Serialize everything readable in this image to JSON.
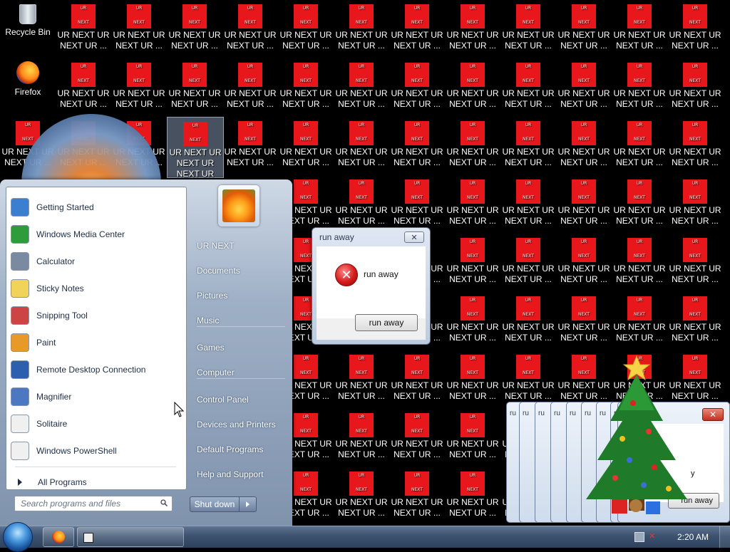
{
  "desktop": {
    "system_icons": [
      {
        "label": "Recycle Bin",
        "icon": "recycle-bin-icon"
      },
      {
        "label": "Firefox",
        "icon": "firefox-icon"
      }
    ],
    "shortcut": {
      "icon_top": "UR",
      "icon_bottom": "NEXT",
      "label_line1": "UR NEXT UR",
      "label_line2": "NEXT UR ...",
      "selected_label": [
        "UR NEXT UR",
        "NEXT UR",
        "NEXT UR"
      ],
      "icon_color": "#E8171B"
    }
  },
  "start_menu": {
    "pinned": [
      {
        "label": "Getting Started",
        "icon": "getting-started-icon"
      },
      {
        "label": "Windows Media Center",
        "icon": "media-center-icon"
      },
      {
        "label": "Calculator",
        "icon": "calculator-icon"
      },
      {
        "label": "Sticky Notes",
        "icon": "sticky-notes-icon"
      },
      {
        "label": "Snipping Tool",
        "icon": "snipping-tool-icon"
      },
      {
        "label": "Paint",
        "icon": "paint-icon"
      },
      {
        "label": "Remote Desktop Connection",
        "icon": "remote-desktop-icon"
      },
      {
        "label": "Magnifier",
        "icon": "magnifier-icon"
      },
      {
        "label": "Solitaire",
        "icon": "solitaire-icon"
      },
      {
        "label": "Windows PowerShell",
        "icon": "powershell-icon"
      }
    ],
    "all_programs": "All Programs",
    "search_placeholder": "Search programs and files",
    "right_items": [
      "UR NEXT",
      "Documents",
      "Pictures",
      "Music",
      "Games",
      "Computer",
      "Control Panel",
      "Devices and Printers",
      "Default Programs",
      "Help and Support"
    ],
    "shutdown_label": "Shut down"
  },
  "dialog": {
    "title": "run away",
    "message": "run away",
    "button": "run away",
    "close_glyph": "✕"
  },
  "stacked_windows": {
    "title_fragment": "ru",
    "front_close": "✕",
    "front_partial_text": "y",
    "front_button": "run away"
  },
  "taskbar": {
    "clock": "2:20 AM",
    "accent": "#3C526F"
  }
}
